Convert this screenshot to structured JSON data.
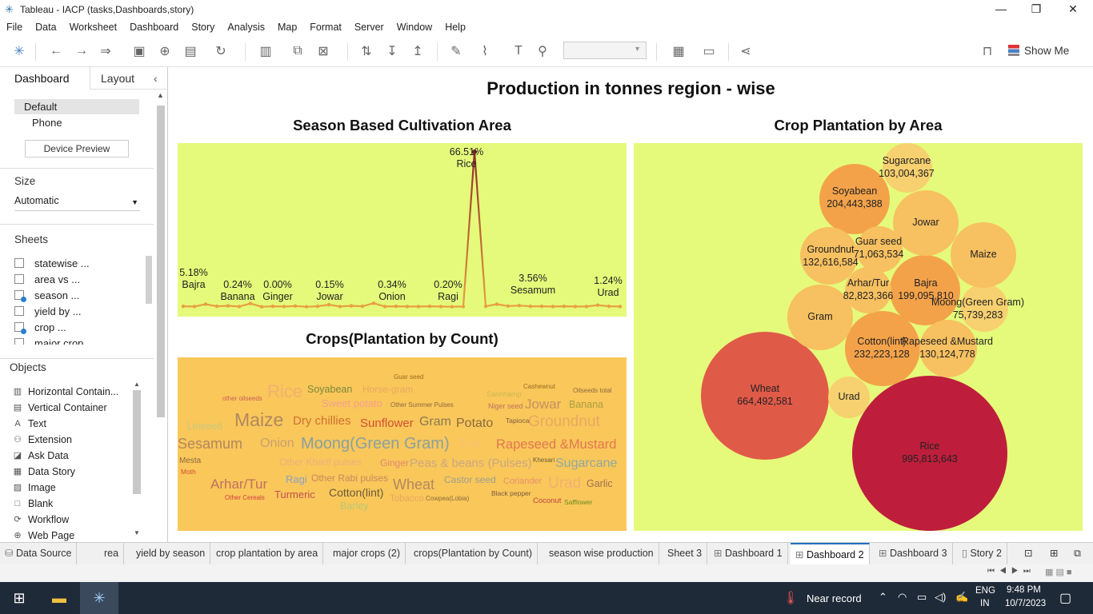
{
  "window": {
    "title": "Tableau - IACP (tasks,Dashboards,story)"
  },
  "menu": [
    "File",
    "Data",
    "Worksheet",
    "Dashboard",
    "Story",
    "Analysis",
    "Map",
    "Format",
    "Server",
    "Window",
    "Help"
  ],
  "toolbar": {
    "show_me": "Show Me"
  },
  "panel": {
    "tab_dashboard": "Dashboard",
    "tab_layout": "Layout",
    "device_default": "Default",
    "device_phone": "Phone",
    "device_preview": "Device Preview",
    "size_label": "Size",
    "size_value": "Automatic",
    "sheets_label": "Sheets",
    "objects_label": "Objects",
    "sheets": [
      {
        "label": "statewise ...",
        "checked": false
      },
      {
        "label": "area vs ...",
        "checked": false
      },
      {
        "label": "season ...",
        "checked": true
      },
      {
        "label": "yield by ...",
        "checked": false
      },
      {
        "label": "crop ...",
        "checked": true
      },
      {
        "label": "major crop",
        "checked": false
      }
    ],
    "objects": [
      {
        "label": "Horizontal Contain...",
        "icon": "horizontal-container-icon"
      },
      {
        "label": "Vertical Container",
        "icon": "vertical-container-icon"
      },
      {
        "label": "Text",
        "icon": "text-icon"
      },
      {
        "label": "Extension",
        "icon": "extension-icon"
      },
      {
        "label": "Ask Data",
        "icon": "ask-data-icon"
      },
      {
        "label": "Data Story",
        "icon": "data-story-icon"
      },
      {
        "label": "Image",
        "icon": "image-icon"
      },
      {
        "label": "Blank",
        "icon": "blank-icon"
      },
      {
        "label": "Workflow",
        "icon": "workflow-icon"
      },
      {
        "label": "Web Page",
        "icon": "web-page-icon"
      }
    ]
  },
  "dashboard": {
    "title": "Production in tonnes region - wise",
    "line_title": "Season Based Cultivation Area",
    "bubble_title": "Crop Plantation by Area",
    "word_title": "Crops(Plantation by Count)"
  },
  "chart_data": [
    {
      "type": "line",
      "title": "Season Based Cultivation Area",
      "line_color": "#b5532a",
      "labels": [
        {
          "pct": "5.18%",
          "name": "Bajra"
        },
        {
          "pct": "0.24%",
          "name": "Banana"
        },
        {
          "pct": "0.00%",
          "name": "Ginger"
        },
        {
          "pct": "0.15%",
          "name": "Jowar"
        },
        {
          "pct": "0.34%",
          "name": "Onion"
        },
        {
          "pct": "0.20%",
          "name": "Ragi"
        },
        {
          "pct": "66.51%",
          "name": "Rice"
        },
        {
          "pct": "3.56%",
          "name": "Sesamum"
        },
        {
          "pct": "1.24%",
          "name": "Urad"
        }
      ],
      "values": [
        0.3,
        0.2,
        1.2,
        0.3,
        0.5,
        0.2,
        1.5,
        0.1,
        0.3,
        0.2,
        0.4,
        0.1,
        0.3,
        1.0,
        0.2,
        0.5,
        0.3,
        1.6,
        0.2,
        0.3,
        0.2,
        0.2,
        0.3,
        0.2,
        0.1,
        0.2,
        66.51,
        0.3,
        1.2,
        0.4,
        0.6,
        0.3,
        0.3,
        0.2,
        0.3,
        0.2,
        0.2,
        0.8,
        0.3,
        0.2
      ]
    },
    {
      "type": "bubble",
      "title": "Crop Plantation by Area",
      "items": [
        {
          "name": "Rice",
          "value": "995,813,643"
        },
        {
          "name": "Wheat",
          "value": "664,492,581"
        },
        {
          "name": "Cotton(lint)",
          "value": "232,223,128"
        },
        {
          "name": "Soyabean",
          "value": "204,443,388"
        },
        {
          "name": "Bajra",
          "value": "199,095,810"
        },
        {
          "name": "Groundnut",
          "value": "132,616,584"
        },
        {
          "name": "Rapeseed &Mustard",
          "value": "130,124,778"
        },
        {
          "name": "Sugarcane",
          "value": "103,004,367"
        },
        {
          "name": "Arhar/Tur",
          "value": "82,823,366"
        },
        {
          "name": "Moong(Green Gram)",
          "value": "75,739,283"
        },
        {
          "name": "Guar seed",
          "value": "71,063,534"
        },
        {
          "name": "Jowar",
          "value": ""
        },
        {
          "name": "Maize",
          "value": ""
        },
        {
          "name": "Gram",
          "value": ""
        },
        {
          "name": "Urad",
          "value": ""
        }
      ]
    },
    {
      "type": "wordcloud",
      "title": "Crops(Plantation by Count)",
      "words": [
        "Guar seed",
        "Cashewnut",
        "Soyabean",
        "Horse-gram",
        "Sannhamp",
        "Oilseeds total",
        "other oilseeds",
        "Rice",
        "Sweet potato",
        "Other Summer Pulses",
        "Niger seed",
        "Jowar",
        "Banana",
        "Linseed",
        "Maize",
        "Dry chillies",
        "Sunflower",
        "Gram",
        "Potato",
        "Tapioca",
        "Groundnut",
        "Sesamum",
        "Onion",
        "Moong(Green Gram)",
        "Jute",
        "Rapeseed &Mustard",
        "Mesta",
        "Other Kharif pulses",
        "Ginger",
        "Peas & beans (Pulses)",
        "Khesari",
        "Sugarcane",
        "Moth",
        "Ragi",
        "Other Rabi pulses",
        "Arhar/Tur",
        "Wheat",
        "Castor seed",
        "Coriander",
        "Urad",
        "Garlic",
        "Other Cereals",
        "Turmeric",
        "Cotton(lint)",
        "Tobacco",
        "Cowpea(Lobia)",
        "Black pepper",
        "Coconut",
        "Safflower",
        "Barley"
      ]
    }
  ],
  "tabs": [
    "Data Source",
    "rea",
    "yield by season",
    "crop plantation by area",
    "major crops (2)",
    "crops(Plantation by Count)",
    "season wise production",
    "Sheet 3",
    "Dashboard 1",
    "Dashboard 2",
    "Dashboard 3",
    "Story 2"
  ],
  "taskbar": {
    "weather": "Near record",
    "lang1": "ENG",
    "lang2": "IN",
    "time": "9:48 PM",
    "date": "10/7/2023"
  }
}
